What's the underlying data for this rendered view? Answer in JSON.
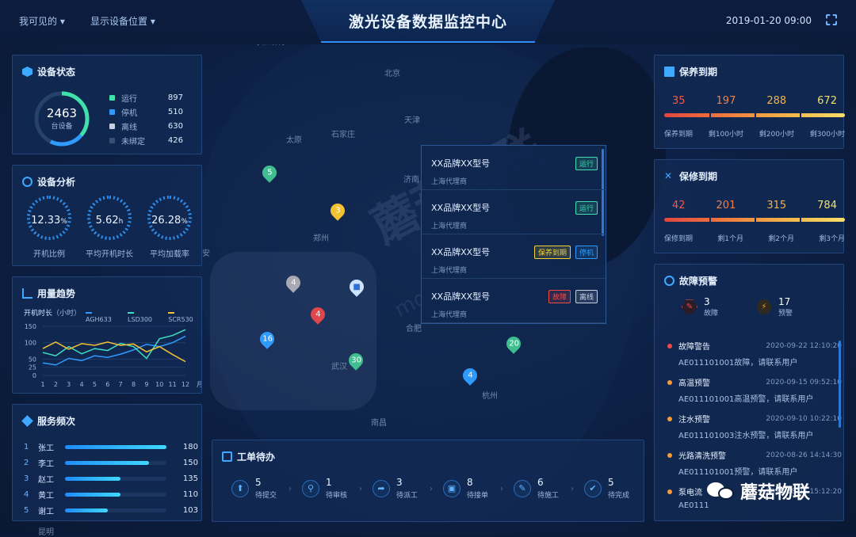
{
  "header": {
    "title": "激光设备数据监控中心",
    "menu1": "我可见的",
    "menu2": "显示设备位置",
    "datetime": "2019-01-20 09:00"
  },
  "device_status": {
    "title": "设备状态",
    "total": "2463",
    "total_label": "台设备",
    "items": [
      {
        "label": "运行",
        "value": "897",
        "color": "#3fe0a9"
      },
      {
        "label": "停机",
        "value": "510",
        "color": "#2f9bff"
      },
      {
        "label": "离线",
        "value": "630",
        "color": "#c7d2e0"
      },
      {
        "label": "未绑定",
        "value": "426",
        "color": "#3a4f72"
      }
    ]
  },
  "device_analysis": {
    "title": "设备分析",
    "gauges": [
      {
        "value": "12.33",
        "unit": "%",
        "label": "开机比例"
      },
      {
        "value": "5.62",
        "unit": "h",
        "label": "平均开机时长"
      },
      {
        "value": "26.28",
        "unit": "%",
        "label": "平均加载率"
      }
    ]
  },
  "usage_trend": {
    "title": "用量趋势",
    "ylabel": "开机时长",
    "yunit": "（小时）",
    "xunit": "月"
  },
  "chart_data": {
    "type": "line",
    "x": [
      1,
      2,
      3,
      4,
      5,
      6,
      7,
      8,
      9,
      10,
      11,
      12
    ],
    "ylim": [
      0,
      150
    ],
    "yticks": [
      0,
      25,
      50,
      100,
      150
    ],
    "series": [
      {
        "name": "AGH633",
        "color": "#2f9bff",
        "values": [
          38,
          32,
          52,
          45,
          60,
          55,
          65,
          78,
          95,
          88,
          100,
          120
        ]
      },
      {
        "name": "LSD300",
        "color": "#3fe0c3",
        "values": [
          70,
          60,
          88,
          66,
          82,
          76,
          98,
          88,
          52,
          112,
          122,
          140
        ]
      },
      {
        "name": "SCR530",
        "color": "#f3c233",
        "values": [
          82,
          102,
          80,
          97,
          92,
          102,
          92,
          96,
          72,
          88,
          64,
          42
        ]
      }
    ]
  },
  "service": {
    "title": "服务频次",
    "rows": [
      {
        "no": "1",
        "name": "张工",
        "value": "180",
        "pct": 1.0
      },
      {
        "no": "2",
        "name": "李工",
        "value": "150",
        "pct": 0.83
      },
      {
        "no": "3",
        "name": "赵工",
        "value": "135",
        "pct": 0.55
      },
      {
        "no": "4",
        "name": "黄工",
        "value": "110",
        "pct": 0.55
      },
      {
        "no": "5",
        "name": "谢工",
        "value": "103",
        "pct": 0.42
      }
    ]
  },
  "maintenance": {
    "title": "保养到期",
    "values": [
      "35",
      "197",
      "288",
      "672"
    ],
    "labels": [
      "保养到期",
      "剩100小时",
      "剩200小时",
      "剩300小时"
    ],
    "colors": [
      "#f05a4b",
      "#f07f4a",
      "#f3b24a",
      "#f7df6a"
    ]
  },
  "repair": {
    "title": "保修到期",
    "values": [
      "42",
      "201",
      "315",
      "784"
    ],
    "labels": [
      "保修到期",
      "剩1个月",
      "剩2个月",
      "剩3个月"
    ],
    "colors": [
      "#f05a4b",
      "#f07f4a",
      "#f3b24a",
      "#f7df6a"
    ]
  },
  "fault": {
    "title": "故障预警",
    "fault_count": "3",
    "fault_label": "故障",
    "warn_count": "17",
    "warn_label": "预警",
    "alarms": [
      {
        "type": "故障警告",
        "time": "2020-09-22  12:10:20",
        "desc": "AE011101001故障，请联系用户",
        "color": "#f04b4b"
      },
      {
        "type": "高温预警",
        "time": "2020-09-15  09:52:10",
        "desc": "AE011101001高温预警，请联系用户",
        "color": "#f59a3c"
      },
      {
        "type": "注水预警",
        "time": "2020-09-10  10:22:10",
        "desc": "AE011101003注水预警，请联系用户",
        "color": "#f59a3c"
      },
      {
        "type": "光路清洗预警",
        "time": "2020-08-26  14:14:30",
        "desc": "AE011101001预警，请联系用户",
        "color": "#f59a3c"
      },
      {
        "type": "泵电流",
        "time": "2020-08-24  15:12:20",
        "desc": "AE0111",
        "color": "#f59a3c"
      }
    ]
  },
  "popup": {
    "rows": [
      {
        "title": "XX品牌XX型号",
        "sub": "上海代理商",
        "tags": [
          {
            "text": "运行",
            "color": "#3fe0a9"
          }
        ]
      },
      {
        "title": "XX品牌XX型号",
        "sub": "上海代理商",
        "tags": [
          {
            "text": "运行",
            "color": "#3fe0a9"
          }
        ]
      },
      {
        "title": "XX品牌XX型号",
        "sub": "上海代理商",
        "tags": [
          {
            "text": "保养到期",
            "color": "#f3d233"
          },
          {
            "text": "停机",
            "color": "#2f9bff"
          }
        ]
      },
      {
        "title": "XX品牌XX型号",
        "sub": "上海代理商",
        "tags": [
          {
            "text": "故障",
            "color": "#f04b4b"
          },
          {
            "text": "离线",
            "color": "#c7d2e0"
          }
        ]
      }
    ]
  },
  "workorder": {
    "title": "工单待办",
    "steps": [
      {
        "count": "5",
        "label": "待提交"
      },
      {
        "count": "1",
        "label": "待审核"
      },
      {
        "count": "3",
        "label": "待派工"
      },
      {
        "count": "8",
        "label": "待接单"
      },
      {
        "count": "6",
        "label": "待施工"
      },
      {
        "count": "5",
        "label": "待完成"
      }
    ]
  },
  "map": {
    "cities": [
      "北京",
      "天津",
      "太原",
      "石家庄",
      "济南",
      "郑州",
      "合肥",
      "武汉",
      "杭州",
      "南昌",
      "呼和浩特",
      "昆明",
      "安"
    ],
    "markers": [
      {
        "n": "5",
        "color": "#3fbf8f"
      },
      {
        "n": "3",
        "color": "#f3c233"
      },
      {
        "n": "4",
        "color": "#a9a9b3"
      },
      {
        "n": "4",
        "color": "#e0474c"
      },
      {
        "n": "16",
        "color": "#2f9bff"
      },
      {
        "n": "30",
        "color": "#3fbf8f"
      },
      {
        "n": "20",
        "color": "#3fbf8f"
      },
      {
        "n": "4",
        "color": "#2f9bff"
      }
    ]
  },
  "watermark": {
    "text": "蘑菇物联",
    "url": "mogulinker.com",
    "brand": "蘑菇物联"
  }
}
